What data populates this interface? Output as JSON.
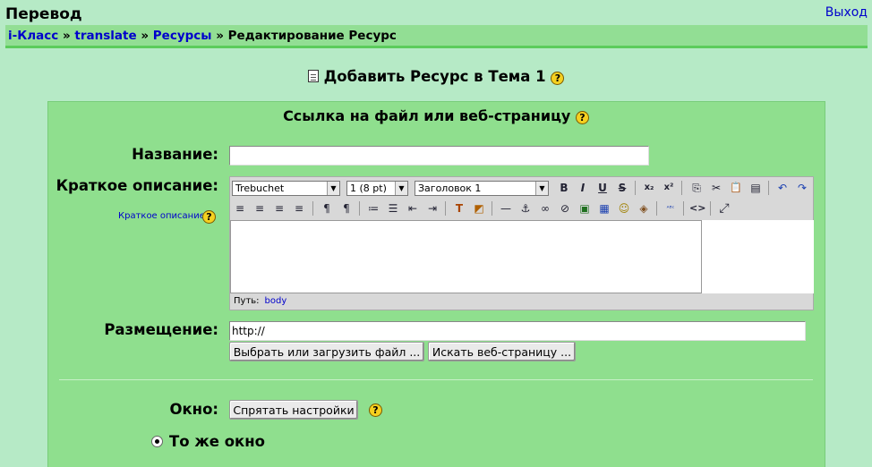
{
  "site": {
    "title": "Перевод",
    "logout": "Выход"
  },
  "breadcrumb": {
    "home": "i-Класс",
    "sep1": "»",
    "course": "translate",
    "sep2": "»",
    "resources": "Ресурсы",
    "sep3": "»",
    "current": "Редактирование Ресурс"
  },
  "page": {
    "heading": "Добавить Ресурс в Тема 1",
    "help": "?"
  },
  "form": {
    "section_heading": "Ссылка на файл или веб-страницу",
    "name_label": "Название:",
    "name_value": "",
    "summary_label": "Краткое описание:",
    "summary_help_link": "Краткое описание",
    "location_label": "Размещение:",
    "location_value": "http://",
    "choose_file_button": "Выбрать или загрузить файл ...",
    "search_web_button": "Искать веб-страницу ...",
    "window_label": "Окно:",
    "hide_settings_button": "Спрятать настройки",
    "same_window_label": "То же окно"
  },
  "editor": {
    "font_select": "Trebuchet",
    "size_select": "1 (8 pt)",
    "format_select": "Заголовок 1",
    "path_label": "Путь:",
    "path_value": "body",
    "buttons_row1": [
      "B",
      "I",
      "U",
      "S",
      "x₂",
      "x²",
      "⎘",
      "✂",
      "📋",
      "▤",
      "↶",
      "↷"
    ],
    "buttons_row2": [
      "≡",
      "≡",
      "≡",
      "≡",
      "¶",
      "¶",
      "≔",
      "☰",
      "⇤",
      "⇥",
      "T",
      "◩",
      "—",
      "⚓",
      "∞",
      "⊘",
      "▣",
      "▦",
      "☺",
      "◈",
      "ᴬᴮᶜ",
      "<>",
      "⤢"
    ]
  }
}
